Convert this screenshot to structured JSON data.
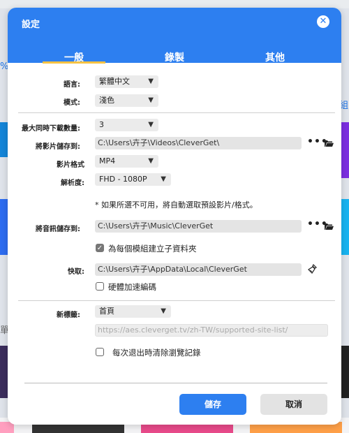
{
  "background": {
    "left_text_1": "%",
    "right_text_1": "組",
    "left_text_2": "單"
  },
  "dialog": {
    "title": "設定",
    "close_glyph": "✕",
    "tabs": [
      {
        "label": "一般",
        "active": true
      },
      {
        "label": "錄製",
        "active": false
      },
      {
        "label": "其他",
        "active": false
      }
    ],
    "language": {
      "label": "語言:",
      "value": "繁體中文"
    },
    "mode": {
      "label": "模式:",
      "value": "淺色"
    },
    "max_downloads": {
      "label": "最大同時下載數量:",
      "value": "3"
    },
    "video_save": {
      "label": "將影片儲存到:",
      "value": "C:\\Users\\卉子\\Videos\\CleverGet\\",
      "more": "•••"
    },
    "video_format": {
      "label": "影片格式",
      "value": "MP4"
    },
    "resolution": {
      "label": "解析度:",
      "value": "FHD - 1080P"
    },
    "note": "* 如果所選不可用，將自動選取預設影片/格式。",
    "audio_save": {
      "label": "將音訊儲存到:",
      "value": "C:\\Users\\卉子\\Music\\CleverGet",
      "more": "•••"
    },
    "subfolder": {
      "label": "為每個模組建立子資料夾",
      "checked": true,
      "check_glyph": "✓"
    },
    "cache": {
      "label": "快取:",
      "value": "C:\\Users\\卉子\\AppData\\Local\\CleverGet"
    },
    "hw_accel": {
      "label": "硬體加速編碼",
      "checked": false
    },
    "new_tab": {
      "label": "新標籤:",
      "value": "首頁"
    },
    "url_placeholder": "https://aes.cleverget.tv/zh-TW/supported-site-list/",
    "clear_history": {
      "label": "每次退出時清除瀏覽記錄",
      "checked": false
    },
    "buttons": {
      "save": "儲存",
      "cancel": "取消"
    },
    "colors": {
      "accent": "#2d7ff0",
      "tab_underline": "#f5c242"
    }
  }
}
